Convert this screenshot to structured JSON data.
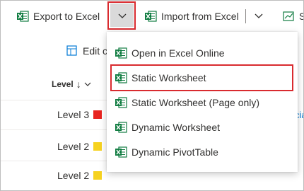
{
  "toolbar": {
    "export_label": "Export to Excel",
    "import_label": "Import from Excel",
    "partial_label": "S"
  },
  "subbar": {
    "edit_label": "Edit c"
  },
  "grid": {
    "column_header": "Level",
    "rows": [
      {
        "label": "Level 3",
        "color": "#e8231f"
      },
      {
        "label": "Level 2",
        "color": "#f6d21f"
      },
      {
        "label": "Level 2",
        "color": "#f6d21f"
      }
    ],
    "side_link": "cia"
  },
  "menu": {
    "items": [
      {
        "label": "Open in Excel Online"
      },
      {
        "label": "Static Worksheet"
      },
      {
        "label": "Static Worksheet (Page only)"
      },
      {
        "label": "Dynamic Worksheet"
      },
      {
        "label": "Dynamic PivotTable"
      }
    ]
  },
  "colors": {
    "highlight": "#d92b2f",
    "excel_green": "#107c41",
    "link": "#0078d4"
  }
}
